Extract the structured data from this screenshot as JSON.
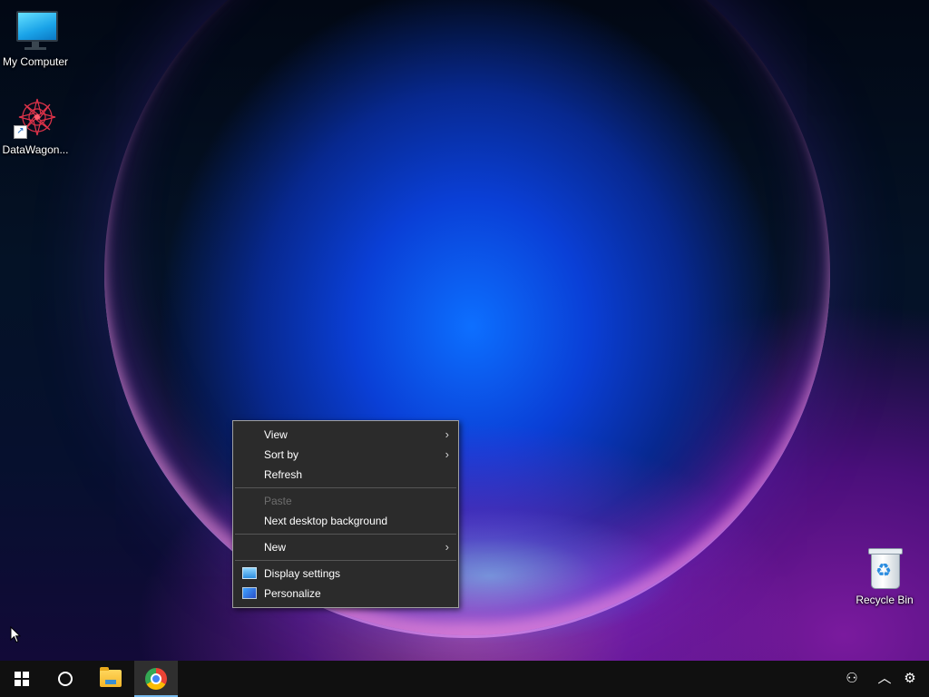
{
  "desktop": {
    "icons": [
      {
        "label": "My Computer",
        "icon": "computer-monitor-icon"
      },
      {
        "label": "DataWagon...",
        "icon": "datawagon-app-icon"
      },
      {
        "label": "Recycle Bin",
        "icon": "recycle-bin-icon"
      }
    ]
  },
  "context_menu": {
    "items": [
      {
        "label": "View",
        "has_submenu": true,
        "enabled": true
      },
      {
        "label": "Sort by",
        "has_submenu": true,
        "enabled": true
      },
      {
        "label": "Refresh",
        "enabled": true
      },
      {
        "label": "Paste",
        "enabled": false
      },
      {
        "label": "Next desktop background",
        "enabled": true
      },
      {
        "label": "New",
        "has_submenu": true,
        "enabled": true
      },
      {
        "label": "Display settings",
        "icon": "display-settings-icon",
        "enabled": true
      },
      {
        "label": "Personalize",
        "icon": "personalize-icon",
        "enabled": true
      }
    ],
    "submenu_arrow": "›"
  },
  "taskbar": {
    "buttons": [
      {
        "name": "start",
        "icon": "windows-logo-icon"
      },
      {
        "name": "cortana",
        "icon": "cortana-circle-icon"
      },
      {
        "name": "file-explorer",
        "icon": "folder-icon"
      },
      {
        "name": "chrome",
        "icon": "chrome-icon",
        "active": true
      }
    ],
    "tray": {
      "people_glyph": "⚇",
      "chevron_glyph": "︿",
      "settings_glyph": "⚙"
    }
  },
  "colors": {
    "menu_bg": "#2b2b2b",
    "menu_border": "#a0a0a0",
    "taskbar_bg": "#101010",
    "active_indicator": "#76b9ed"
  }
}
